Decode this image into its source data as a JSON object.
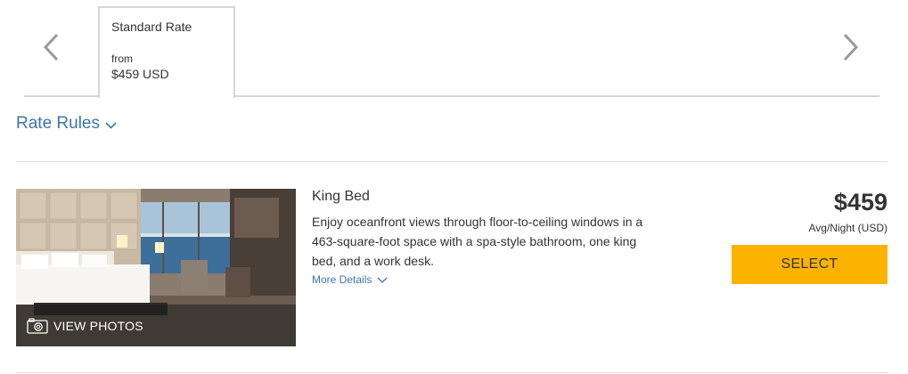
{
  "rate_tab": {
    "title": "Standard Rate",
    "from_label": "from",
    "price": "$459 USD"
  },
  "nav": {
    "prev_icon": "chevron-left-icon",
    "next_icon": "chevron-right-icon"
  },
  "rate_rules": {
    "label": "Rate Rules",
    "icon": "chevron-down-icon"
  },
  "room": {
    "name": "King Bed",
    "description": "Enjoy oceanfront views through floor-to-ceiling windows in a 463-square-foot space with a spa-style bathroom, one king bed, and a work desk.",
    "more_details": "More Details",
    "view_photos": "VIEW PHOTOS",
    "camera_icon": "camera-icon",
    "price": "$459",
    "price_note": "Avg/Night (USD)",
    "select_label": "SELECT"
  },
  "colors": {
    "link": "#3b75ad",
    "select_button": "#fbb300",
    "border": "#d6d6d6"
  }
}
